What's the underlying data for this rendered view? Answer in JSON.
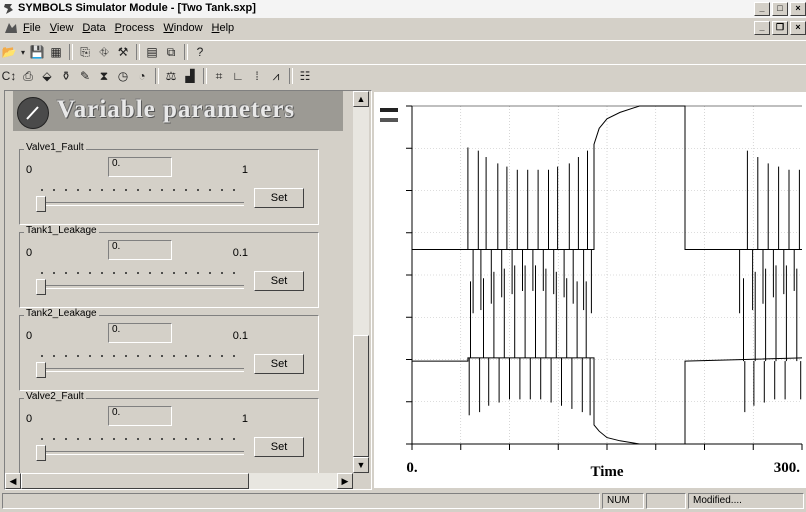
{
  "window": {
    "title": "SYMBOLS Simulator Module - [Two Tank.sxp]",
    "controls": [
      "_",
      "□",
      "×"
    ],
    "mdi_controls": [
      "_",
      "❐",
      "×"
    ]
  },
  "menu": [
    {
      "key": "F",
      "rest": "ile"
    },
    {
      "key": "V",
      "rest": "iew"
    },
    {
      "key": "D",
      "rest": "ata"
    },
    {
      "key": "P",
      "rest": "rocess"
    },
    {
      "key": "W",
      "rest": "indow"
    },
    {
      "key": "H",
      "rest": "elp"
    }
  ],
  "panel": {
    "header": "Variable parameters",
    "groups": [
      {
        "name": "Valve1_Fault",
        "min": "0",
        "max": "1",
        "value": "0.",
        "slider_fraction": 0,
        "set_label": "Set"
      },
      {
        "name": "Tank1_Leakage",
        "min": "0",
        "max": "0.1",
        "value": "0.",
        "slider_fraction": 0,
        "set_label": "Set"
      },
      {
        "name": "Tank2_Leakage",
        "min": "0",
        "max": "0.1",
        "value": "0.",
        "slider_fraction": 0,
        "set_label": "Set"
      },
      {
        "name": "Valve2_Fault",
        "min": "0",
        "max": "1",
        "value": "0.",
        "slider_fraction": 0,
        "set_label": "Set"
      }
    ]
  },
  "chart_data": {
    "type": "line",
    "xlabel": "Time",
    "xlim": [
      0,
      300
    ],
    "x_tick_labels": [
      "0.",
      "300."
    ],
    "series": [
      {
        "points": [
          [
            0,
            0.55
          ],
          [
            43,
            0.55
          ],
          [
            43,
            0.55
          ],
          [
            140,
            0.55
          ],
          [
            140,
            0.88
          ],
          [
            144,
            0.93
          ],
          [
            150,
            0.96
          ],
          [
            160,
            0.98
          ],
          [
            175,
            1.0
          ],
          [
            210,
            1.0
          ],
          [
            210,
            0.55
          ],
          [
            300,
            0.55
          ]
        ],
        "spikes_up": [
          [
            43,
            0.87
          ],
          [
            51,
            0.86
          ],
          [
            57,
            0.84
          ],
          [
            66,
            0.82
          ],
          [
            73,
            0.81
          ],
          [
            81,
            0.8
          ],
          [
            89,
            0.8
          ],
          [
            97,
            0.8
          ],
          [
            105,
            0.8
          ],
          [
            112,
            0.81
          ],
          [
            121,
            0.82
          ],
          [
            128,
            0.84
          ],
          [
            135,
            0.86
          ],
          [
            258,
            0.86
          ],
          [
            266,
            0.84
          ],
          [
            274,
            0.82
          ],
          [
            282,
            0.81
          ],
          [
            290,
            0.8
          ],
          [
            298,
            0.8
          ]
        ],
        "spikes_down": [
          [
            47,
            0.35
          ],
          [
            53,
            0.36
          ],
          [
            61,
            0.38
          ],
          [
            69,
            0.4
          ],
          [
            77,
            0.41
          ],
          [
            85,
            0.42
          ],
          [
            93,
            0.42
          ],
          [
            101,
            0.42
          ],
          [
            109,
            0.41
          ],
          [
            117,
            0.4
          ],
          [
            124,
            0.38
          ],
          [
            132,
            0.36
          ],
          [
            138,
            0.35
          ],
          [
            252,
            0.35
          ],
          [
            262,
            0.36
          ],
          [
            270,
            0.38
          ],
          [
            278,
            0.4
          ],
          [
            286,
            0.41
          ],
          [
            294,
            0.42
          ]
        ]
      },
      {
        "points": [
          [
            0,
            0.2
          ],
          [
            43,
            0.2
          ],
          [
            43,
            0.21
          ],
          [
            140,
            0.21
          ],
          [
            140,
            0.0
          ],
          [
            144,
            -0.02
          ],
          [
            150,
            -0.04
          ],
          [
            160,
            -0.05
          ],
          [
            175,
            -0.06
          ],
          [
            210,
            -0.06
          ],
          [
            210,
            0.2
          ],
          [
            300,
            0.21
          ]
        ],
        "spikes_up": [
          [
            45,
            0.45
          ],
          [
            55,
            0.46
          ],
          [
            63,
            0.48
          ],
          [
            71,
            0.49
          ],
          [
            79,
            0.5
          ],
          [
            87,
            0.5
          ],
          [
            95,
            0.5
          ],
          [
            103,
            0.49
          ],
          [
            111,
            0.48
          ],
          [
            119,
            0.46
          ],
          [
            127,
            0.45
          ],
          [
            134,
            0.45
          ],
          [
            255,
            0.46
          ],
          [
            264,
            0.48
          ],
          [
            272,
            0.49
          ],
          [
            280,
            0.5
          ],
          [
            288,
            0.5
          ],
          [
            296,
            0.49
          ]
        ],
        "spikes_down": [
          [
            44,
            0.03
          ],
          [
            52,
            0.04
          ],
          [
            59,
            0.06
          ],
          [
            67,
            0.07
          ],
          [
            75,
            0.08
          ],
          [
            83,
            0.08
          ],
          [
            91,
            0.08
          ],
          [
            99,
            0.08
          ],
          [
            107,
            0.07
          ],
          [
            115,
            0.06
          ],
          [
            123,
            0.05
          ],
          [
            131,
            0.04
          ],
          [
            137,
            0.03
          ],
          [
            256,
            0.04
          ],
          [
            263,
            0.06
          ],
          [
            271,
            0.07
          ],
          [
            279,
            0.08
          ],
          [
            287,
            0.08
          ],
          [
            299,
            0.08
          ]
        ]
      }
    ]
  },
  "status": {
    "num": "NUM",
    "modified": "Modified...."
  }
}
